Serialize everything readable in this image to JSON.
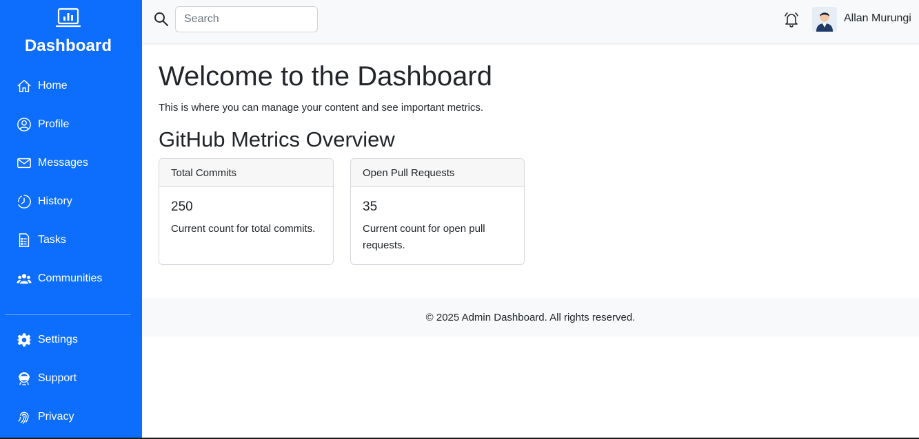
{
  "sidebar": {
    "brand": {
      "title": "Dashboard",
      "icon": "bar-chart-icon"
    },
    "main_items": [
      {
        "label": "Home",
        "icon": "house-icon"
      },
      {
        "label": "Profile",
        "icon": "person-circle-icon"
      },
      {
        "label": "Messages",
        "icon": "envelope-icon"
      },
      {
        "label": "History",
        "icon": "clock-history-icon"
      },
      {
        "label": "Tasks",
        "icon": "file-list-icon"
      },
      {
        "label": "Communities",
        "icon": "people-icon"
      }
    ],
    "bottom_items": [
      {
        "label": "Settings",
        "icon": "gear-icon"
      },
      {
        "label": "Support",
        "icon": "headset-icon"
      },
      {
        "label": "Privacy",
        "icon": "fingerprint-icon"
      }
    ],
    "color": "#0d6efd"
  },
  "topbar": {
    "search": {
      "placeholder": "Search",
      "value": ""
    },
    "notification_icon": "bell-icon",
    "user": {
      "name": "Allan Murungi",
      "avatar": "avatar"
    }
  },
  "main": {
    "title": "Welcome to the Dashboard",
    "subtitle": "This is where you can manage your content and see important metrics.",
    "section_title": "GitHub Metrics Overview",
    "cards": [
      {
        "header": "Total Commits",
        "value": "250",
        "text": "Current count for total commits."
      },
      {
        "header": "Open Pull Requests",
        "value": "35",
        "text": "Current count for open pull requests."
      }
    ]
  },
  "footer": {
    "text": "© 2025 Admin Dashboard. All rights reserved."
  }
}
